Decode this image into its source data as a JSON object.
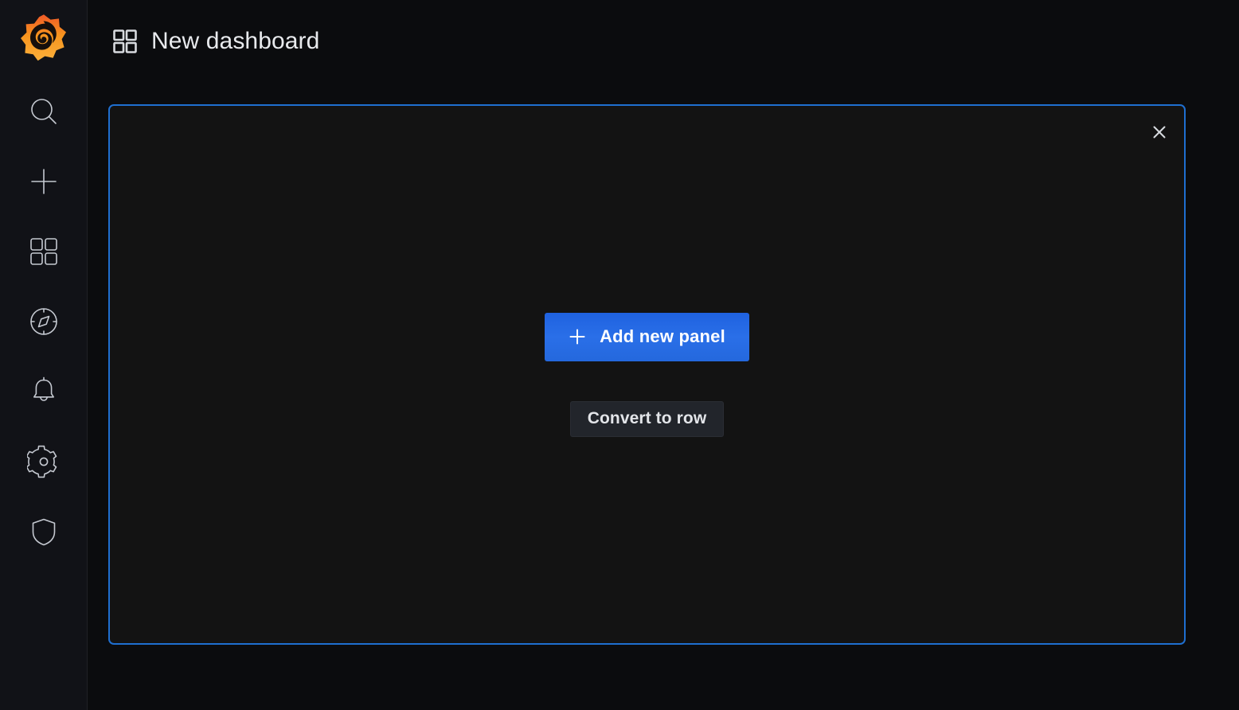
{
  "app": {
    "name": "Grafana",
    "logo_icon": "grafana-logo-icon",
    "colors": {
      "page_background": "#0b0c0e",
      "sidebar_background": "#111217",
      "panel_background": "#131313",
      "panel_border_accent": "#1f6fd0",
      "primary_button": "#2a6fe8",
      "secondary_button": "#22252b",
      "logo_orange": "#f05a28",
      "logo_yellow": "#fbb03b",
      "text_primary": "#e8eaed",
      "icon_gray": "#c5c9d1"
    }
  },
  "sidebar": {
    "items": [
      {
        "name": "search",
        "icon": "search-icon",
        "label": "Search"
      },
      {
        "name": "create",
        "icon": "plus-icon",
        "label": "Create"
      },
      {
        "name": "dashboards",
        "icon": "apps-grid-icon",
        "label": "Dashboards"
      },
      {
        "name": "explore",
        "icon": "compass-icon",
        "label": "Explore"
      },
      {
        "name": "alerting",
        "icon": "bell-icon",
        "label": "Alerting"
      },
      {
        "name": "configuration",
        "icon": "gear-icon",
        "label": "Configuration"
      },
      {
        "name": "server-admin",
        "icon": "shield-icon",
        "label": "Server Admin"
      }
    ]
  },
  "header": {
    "icon": "apps-grid-icon",
    "title": "New dashboard"
  },
  "panel": {
    "state": "add-panel-placeholder",
    "close_icon": "close-icon",
    "close_label": "Close",
    "add_panel": {
      "icon": "plus-icon",
      "label": "Add new panel"
    },
    "convert_to_row": {
      "label": "Convert to row"
    }
  }
}
